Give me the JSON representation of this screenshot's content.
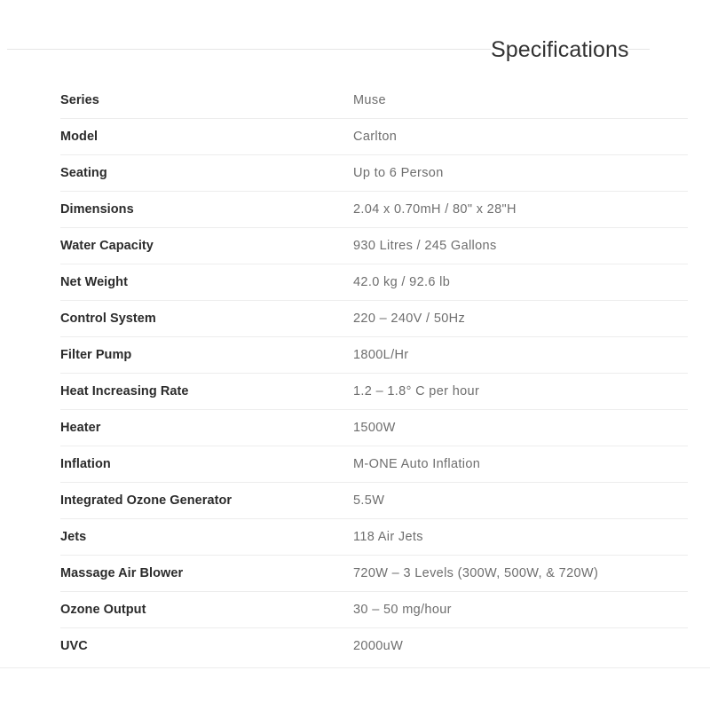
{
  "header": {
    "title": "Specifications"
  },
  "specifications": {
    "rows": [
      {
        "label": "Series",
        "value": "Muse"
      },
      {
        "label": "Model",
        "value": "Carlton"
      },
      {
        "label": "Seating",
        "value": "Up to 6 Person"
      },
      {
        "label": "Dimensions",
        "value": "2.04 x 0.70mH / 80\" x 28\"H"
      },
      {
        "label": "Water Capacity",
        "value": "930 Litres / 245 Gallons"
      },
      {
        "label": "Net Weight",
        "value": "42.0 kg / 92.6 lb"
      },
      {
        "label": "Control System",
        "value": "220 – 240V / 50Hz"
      },
      {
        "label": "Filter Pump",
        "value": "1800L/Hr"
      },
      {
        "label": "Heat Increasing Rate",
        "value": "1.2 – 1.8° C per hour"
      },
      {
        "label": "Heater",
        "value": "1500W"
      },
      {
        "label": "Inflation",
        "value": "M-ONE Auto Inflation"
      },
      {
        "label": "Integrated Ozone Generator",
        "value": "5.5W"
      },
      {
        "label": "Jets",
        "value": "118 Air Jets"
      },
      {
        "label": "Massage Air Blower",
        "value": "720W – 3 Levels (300W, 500W, & 720W)"
      },
      {
        "label": "Ozone Output",
        "value": "30 – 50 mg/hour"
      },
      {
        "label": "UVC",
        "value": "2000uW"
      }
    ]
  },
  "colors": {
    "label_text": "#2b2b2b",
    "value_text": "#6e6e6e",
    "title_text": "#333333",
    "rule": "#e6e6e6",
    "row_separator": "#ededed",
    "background": "#ffffff"
  }
}
